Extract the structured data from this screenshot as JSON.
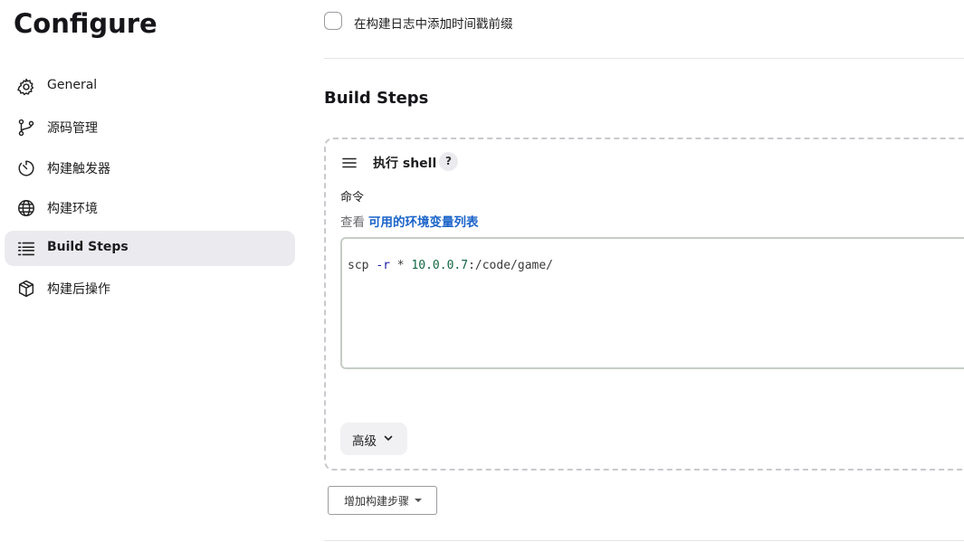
{
  "page": {
    "title": "Configure"
  },
  "sidebar": {
    "items": [
      {
        "label": "General",
        "icon": "gear-icon"
      },
      {
        "label": "源码管理",
        "icon": "branch-icon"
      },
      {
        "label": "构建触发器",
        "icon": "timer-icon"
      },
      {
        "label": "构建环境",
        "icon": "globe-icon"
      },
      {
        "label": "Build Steps",
        "icon": "list-icon",
        "active": true
      },
      {
        "label": "构建后操作",
        "icon": "package-icon"
      }
    ]
  },
  "timestamp_option": {
    "label": "在构建日志中添加时间戳前缀",
    "checked": false
  },
  "build_steps": {
    "title": "Build Steps",
    "step": {
      "title": "执行 shell",
      "help": "?",
      "command_label": "命令",
      "see_prefix": "查看",
      "env_link": "可用的环境变量列表",
      "command_value": "scp -r * 10.0.0.7:/code/game/",
      "advanced_label": "高级"
    },
    "add_step_label": "增加构建步骤"
  },
  "colors": {
    "link": "#1a63c9",
    "active_nav_bg": "#ebebef"
  }
}
